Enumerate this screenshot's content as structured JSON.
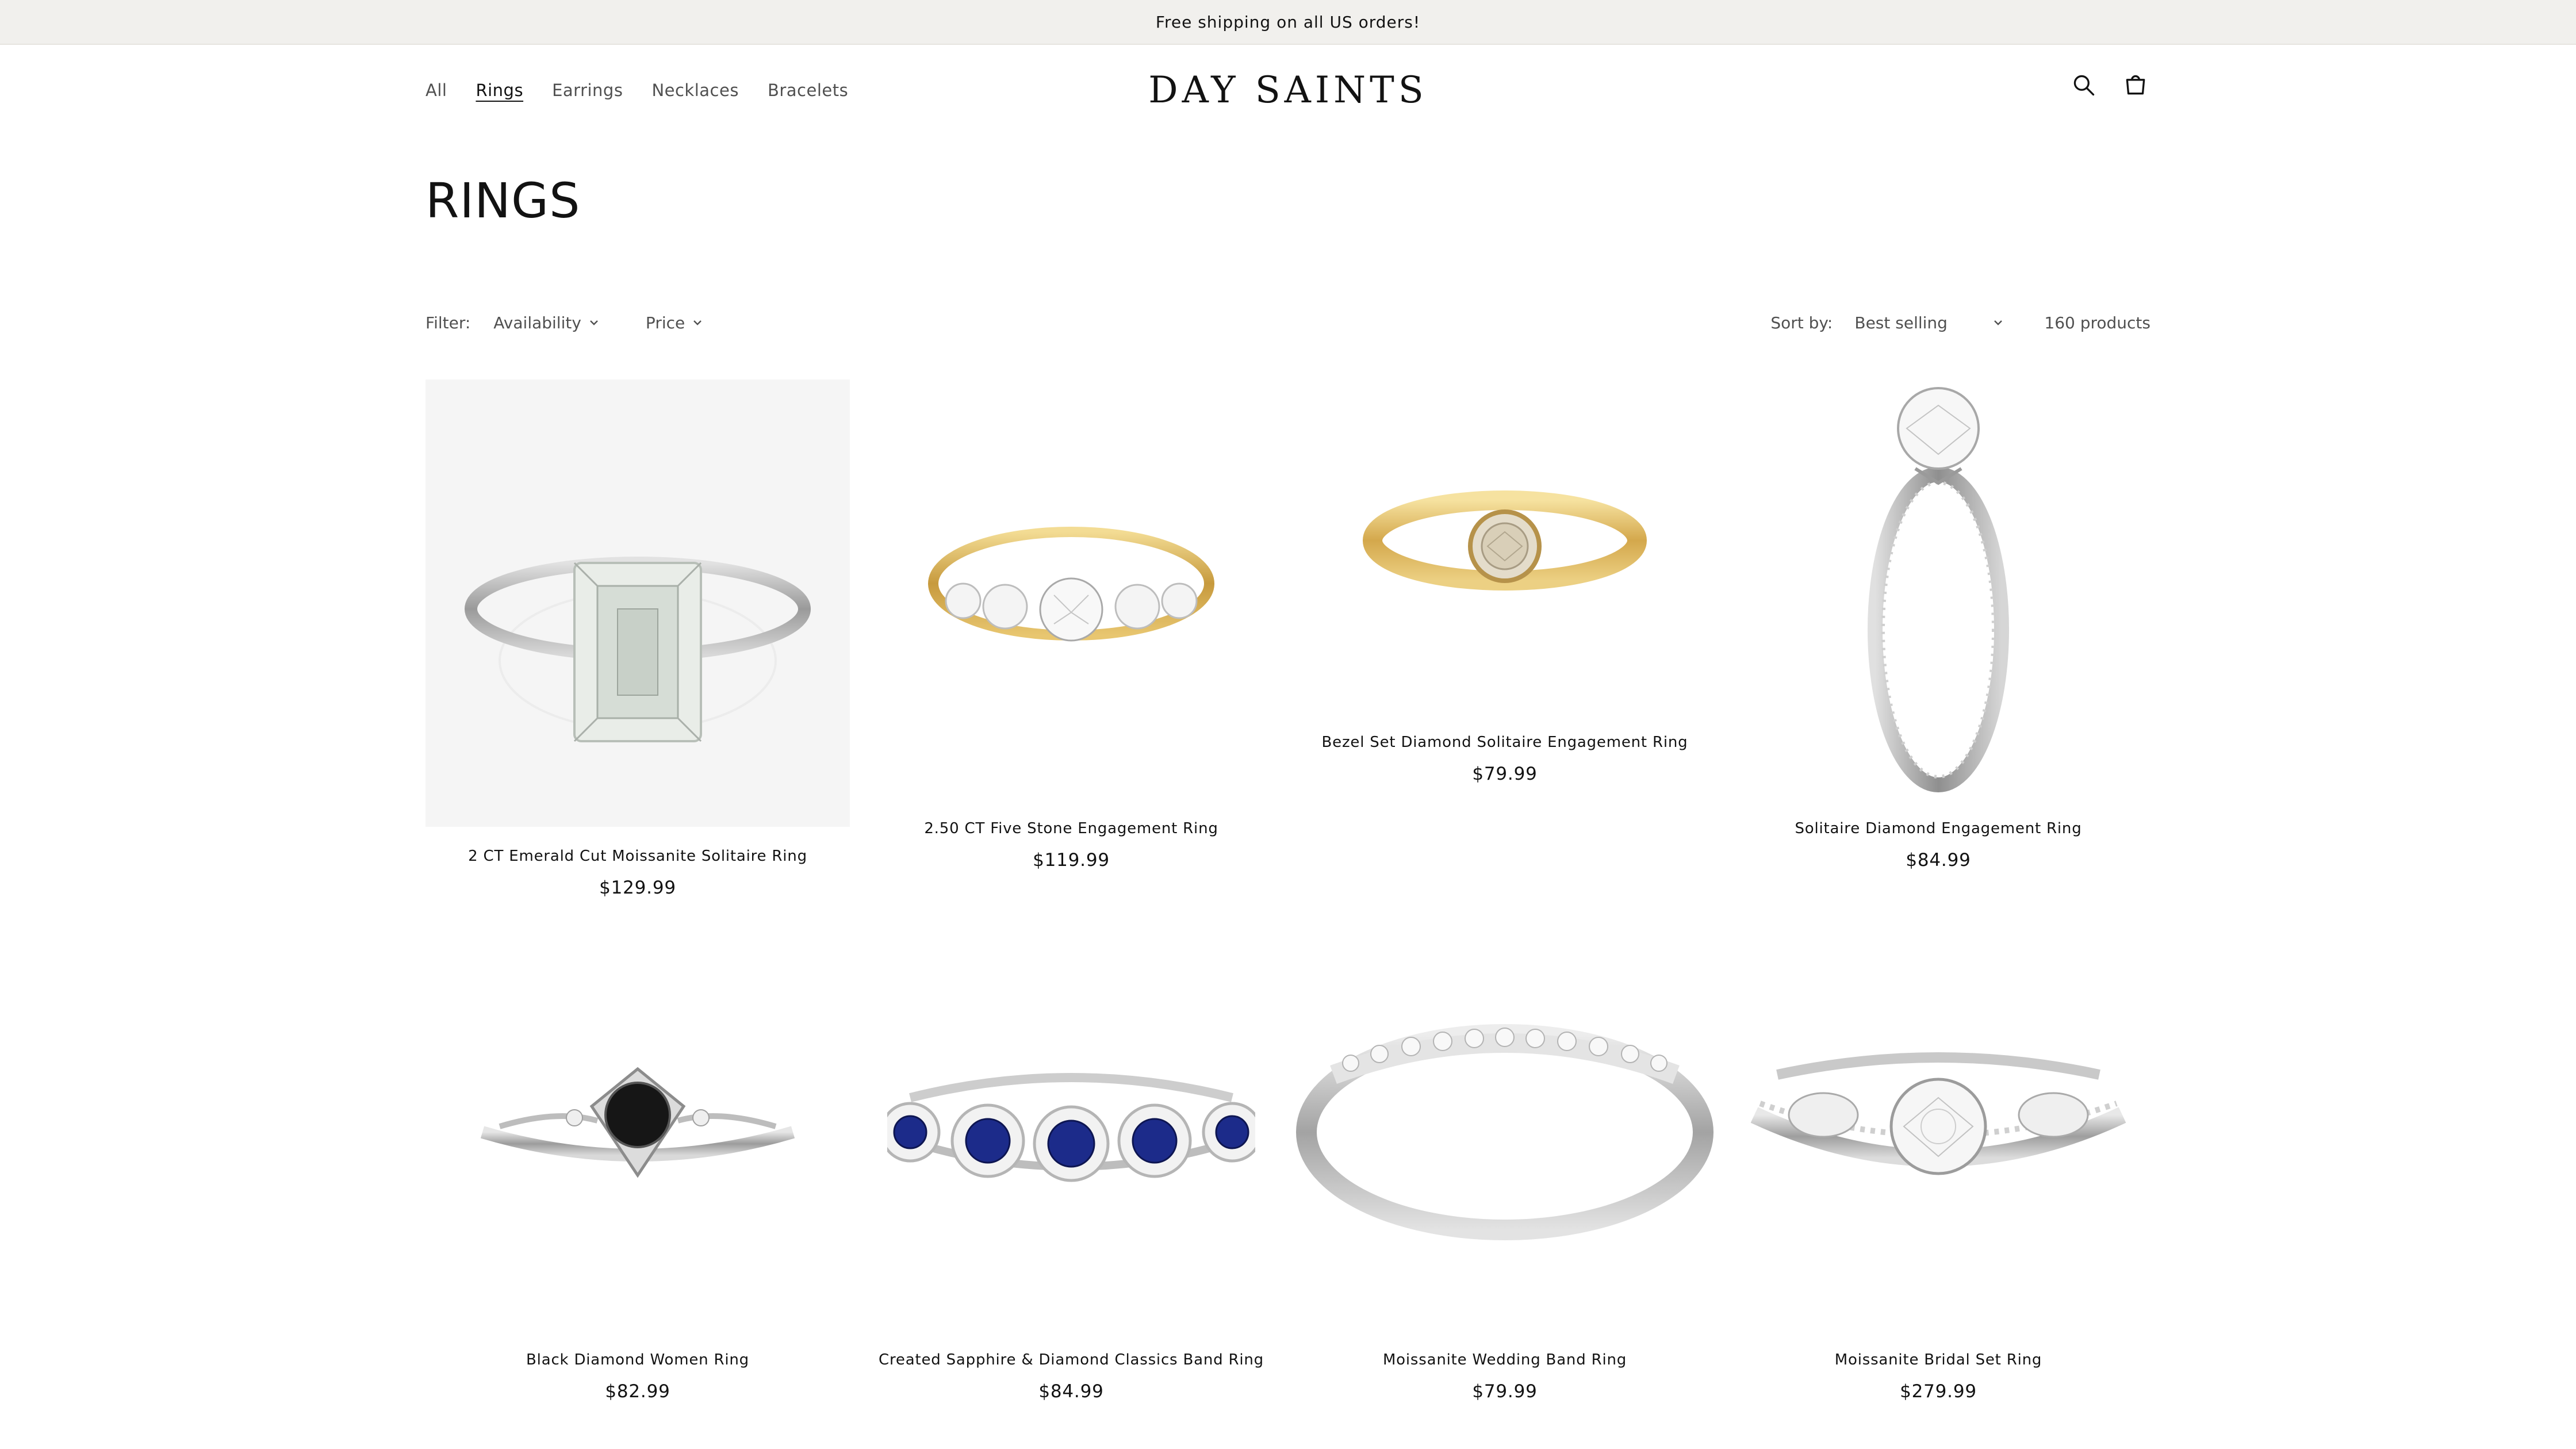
{
  "announcement": "Free shipping on all US orders!",
  "nav": {
    "items": [
      "All",
      "Rings",
      "Earrings",
      "Necklaces",
      "Bracelets"
    ],
    "active": "Rings"
  },
  "brand": "DAY SAINTS",
  "icons": {
    "search": "search-icon",
    "cart": "cart-icon"
  },
  "page": {
    "title": "RINGS"
  },
  "filters": {
    "label": "Filter:",
    "availability": "Availability",
    "price": "Price",
    "sort_label": "Sort by:",
    "sort_value": "Best selling",
    "count": "160 products"
  },
  "colors": {
    "gold": "#d8b45a",
    "silver": "#c4c4c4",
    "sapphire": "#1c2b8a",
    "black_stone": "#161616"
  },
  "products": [
    {
      "name": "2 CT Emerald Cut Moissanite Solitaire Ring",
      "price": "$129.99"
    },
    {
      "name": "2.50 CT Five Stone Engagement Ring",
      "price": "$119.99"
    },
    {
      "name": "Bezel Set Diamond Solitaire Engagement Ring",
      "price": "$79.99"
    },
    {
      "name": "Solitaire Diamond Engagement Ring",
      "price": "$84.99"
    },
    {
      "name": "Black Diamond Women Ring",
      "price": "$82.99"
    },
    {
      "name": "Created Sapphire & Diamond Classics Band Ring",
      "price": "$84.99"
    },
    {
      "name": "Moissanite Wedding Band Ring",
      "price": "$79.99"
    },
    {
      "name": "Moissanite Bridal Set Ring",
      "price": "$279.99"
    }
  ]
}
